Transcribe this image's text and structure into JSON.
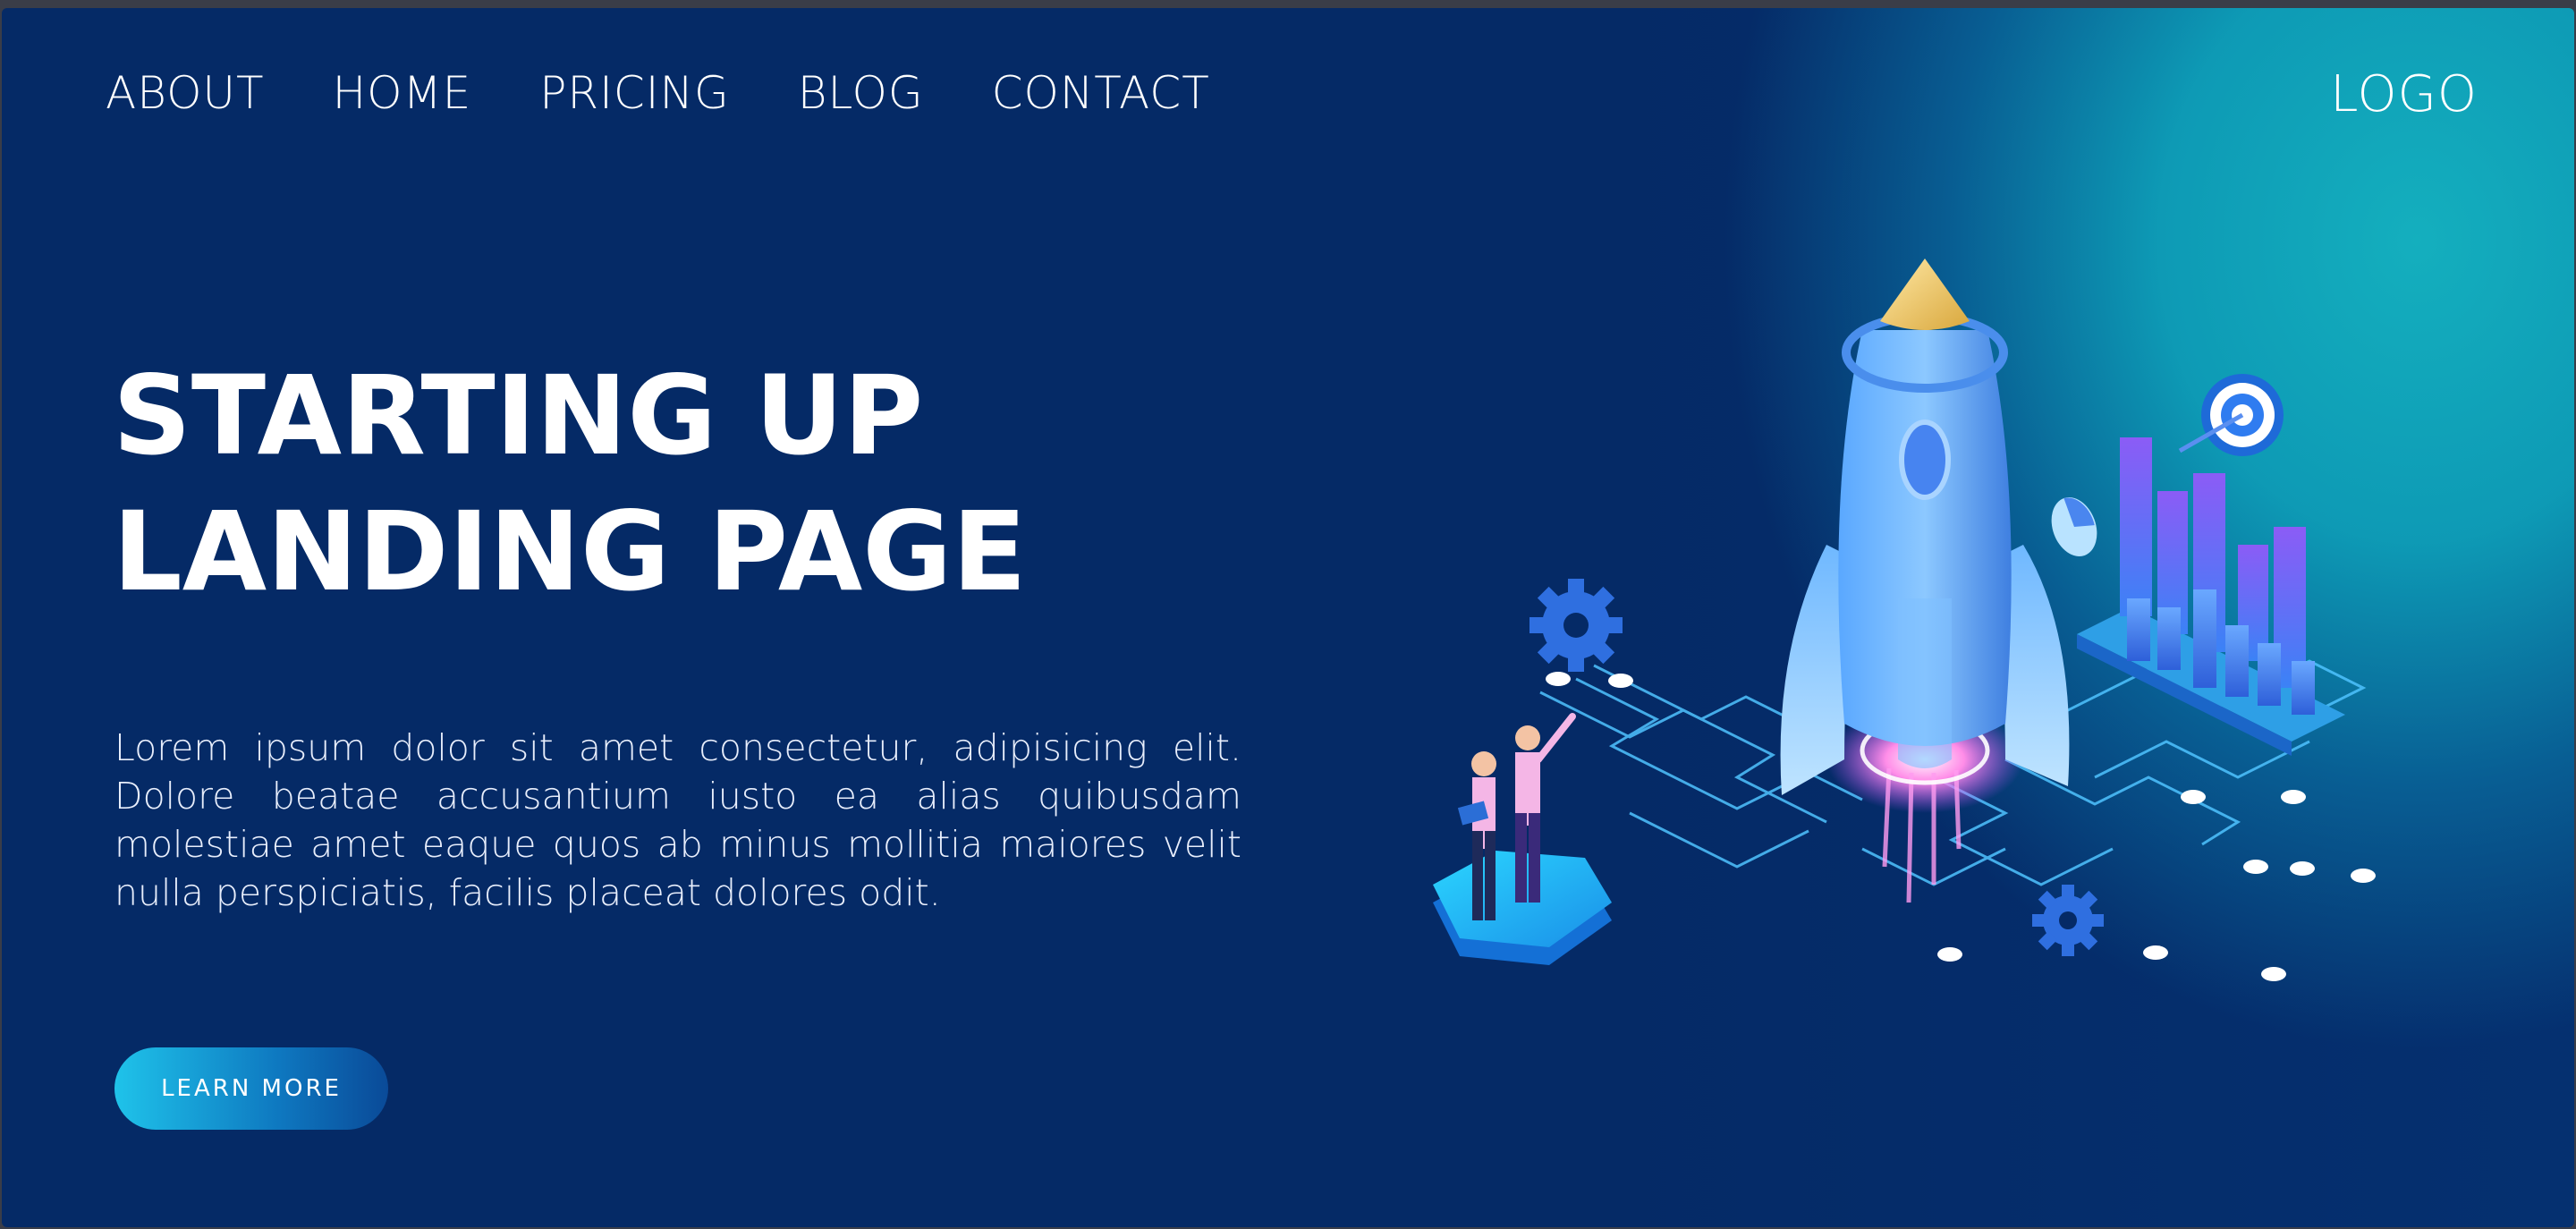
{
  "nav": {
    "items": [
      {
        "label": "ABOUT"
      },
      {
        "label": "HOME"
      },
      {
        "label": "PRICING"
      },
      {
        "label": "BLOG"
      },
      {
        "label": "CONTACT"
      }
    ],
    "logo": "LOGO"
  },
  "hero": {
    "headline_line1": "STARTING UP",
    "headline_line2": "LANDING PAGE",
    "body": "Lorem ipsum dolor sit amet consectetur, adipisicing elit. Dolore beatae accusantium iusto ea alias quibusdam molestiae amet eaque quos ab minus mollitia maiores velit nulla perspiciatis, facilis placeat dolores odit.",
    "cta_label": "LEARN MORE"
  },
  "colors": {
    "background": "#052a66",
    "accent_teal": "#14afbe",
    "button_start": "#1fc3ea",
    "button_end": "#0a4a98"
  },
  "illustration": {
    "icons": [
      "rocket-icon",
      "gear-icon",
      "bar-chart-icon",
      "target-icon",
      "people-icon",
      "circuit-icon"
    ]
  }
}
